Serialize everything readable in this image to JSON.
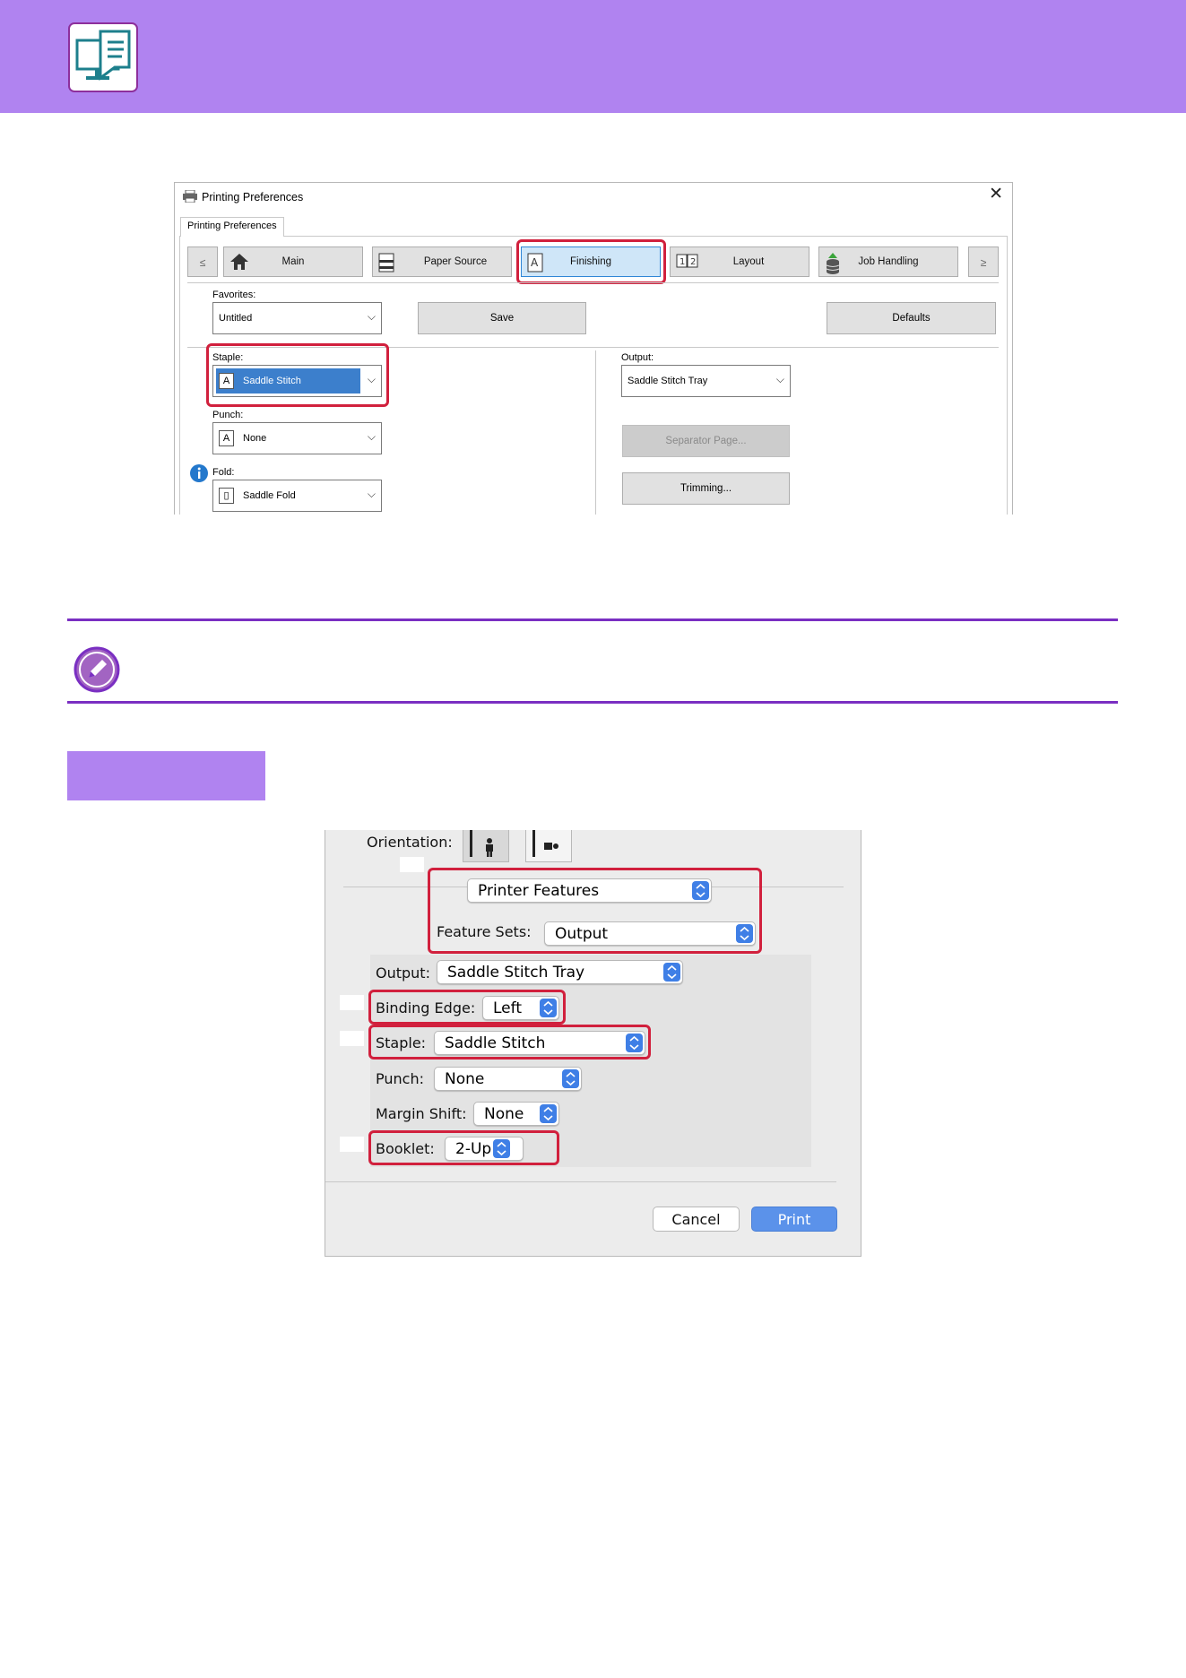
{
  "windows_dialog": {
    "title": "Printing Preferences",
    "tab": "Printing Preferences",
    "nav": {
      "prev": "≤",
      "next": "≥",
      "main": "Main",
      "paper_source": "Paper Source",
      "finishing": "Finishing",
      "layout": "Layout",
      "job_handling": "Job Handling"
    },
    "favorites": {
      "label": "Favorites:",
      "value": "Untitled"
    },
    "save_button": "Save",
    "defaults_button": "Defaults",
    "staple": {
      "label": "Staple:",
      "value": "Saddle Stitch"
    },
    "punch": {
      "label": "Punch:",
      "value": "None"
    },
    "fold": {
      "label": "Fold:",
      "value": "Saddle Fold"
    },
    "output": {
      "label": "Output:",
      "value": "Saddle Stitch Tray"
    },
    "separator_page_button": "Separator Page...",
    "trimming_button": "Trimming..."
  },
  "mac_dialog": {
    "orientation_label": "Orientation:",
    "panel_menu": "Printer Features",
    "feature_sets": {
      "label": "Feature Sets:",
      "value": "Output"
    },
    "output": {
      "label": "Output:",
      "value": "Saddle Stitch Tray"
    },
    "binding_edge": {
      "label": "Binding Edge:",
      "value": "Left"
    },
    "staple": {
      "label": "Staple:",
      "value": "Saddle Stitch"
    },
    "punch": {
      "label": "Punch:",
      "value": "None"
    },
    "margin_shift": {
      "label": "Margin Shift:",
      "value": "None"
    },
    "booklet": {
      "label": "Booklet:",
      "value": "2-Up"
    },
    "cancel_button": "Cancel",
    "print_button": "Print"
  },
  "colors": {
    "header_band": "#b083f0",
    "highlight": "#d1203d",
    "note_rule": "#7a2fc2",
    "mac_accent": "#3f7fe6"
  }
}
